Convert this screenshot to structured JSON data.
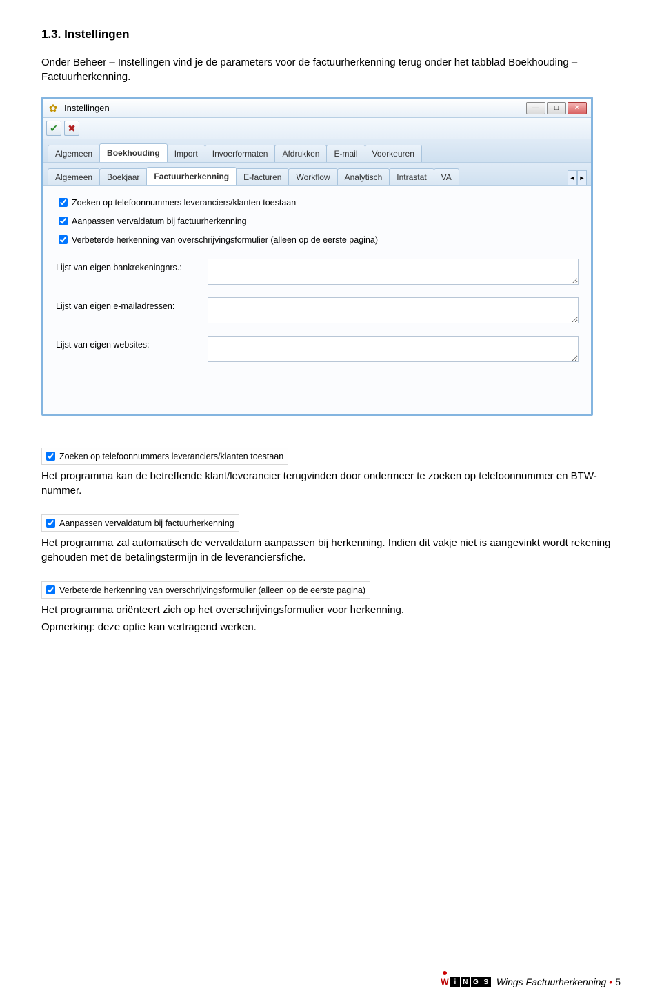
{
  "heading": "1.3.   Instellingen",
  "intro": "Onder Beheer – Instellingen vind je de parameters voor de factuurherkenning terug onder het tabblad Boekhouding – Factuurherkenning.",
  "window": {
    "title": "Instellingen",
    "toolbar": {
      "ok": "✔",
      "cancel": "✖"
    },
    "winbtns": {
      "min": "—",
      "max": "□",
      "close": "✕"
    },
    "tabs1": [
      "Algemeen",
      "Boekhouding",
      "Import",
      "Invoerformaten",
      "Afdrukken",
      "E-mail",
      "Voorkeuren"
    ],
    "tabs1_active": 1,
    "tabs2": [
      "Algemeen",
      "Boekjaar",
      "Factuurherkenning",
      "E-facturen",
      "Workflow",
      "Analytisch",
      "Intrastat",
      "VA"
    ],
    "tabs2_active": 2,
    "tabs2_scroll_left": "◄",
    "tabs2_scroll_right": "►",
    "check1": "Zoeken op telefoonnummers leveranciers/klanten toestaan",
    "check2": "Aanpassen vervaldatum bij factuurherkenning",
    "check3": "Verbeterde herkenning van overschrijvingsformulier (alleen op de eerste pagina)",
    "field1": "Lijst van eigen bankrekeningnrs.:",
    "field2": "Lijst van eigen e-mailadressen:",
    "field3": "Lijst van eigen websites:"
  },
  "snip1": "Zoeken op telefoonnummers leveranciers/klanten toestaan",
  "para1": "Het programma kan de betreffende klant/leverancier terugvinden door ondermeer te zoeken op telefoonnummer en BTW-nummer.",
  "snip2": "Aanpassen vervaldatum bij factuurherkenning",
  "para2": "Het programma zal automatisch de vervaldatum aanpassen bij herkenning. Indien dit vakje niet is aangevinkt wordt rekening gehouden met de betalingstermijn in de leveranciersfiche.",
  "snip3": "Verbeterde herkenning van overschrijvingsformulier (alleen op de eerste pagina)",
  "para3a": "Het programma oriënteert zich op het overschrijvingsformulier voor herkenning.",
  "para3b": "Opmerking:  deze optie kan vertragend werken.",
  "footer": {
    "brand": "Wings Factuurherkenning",
    "page": "5"
  }
}
